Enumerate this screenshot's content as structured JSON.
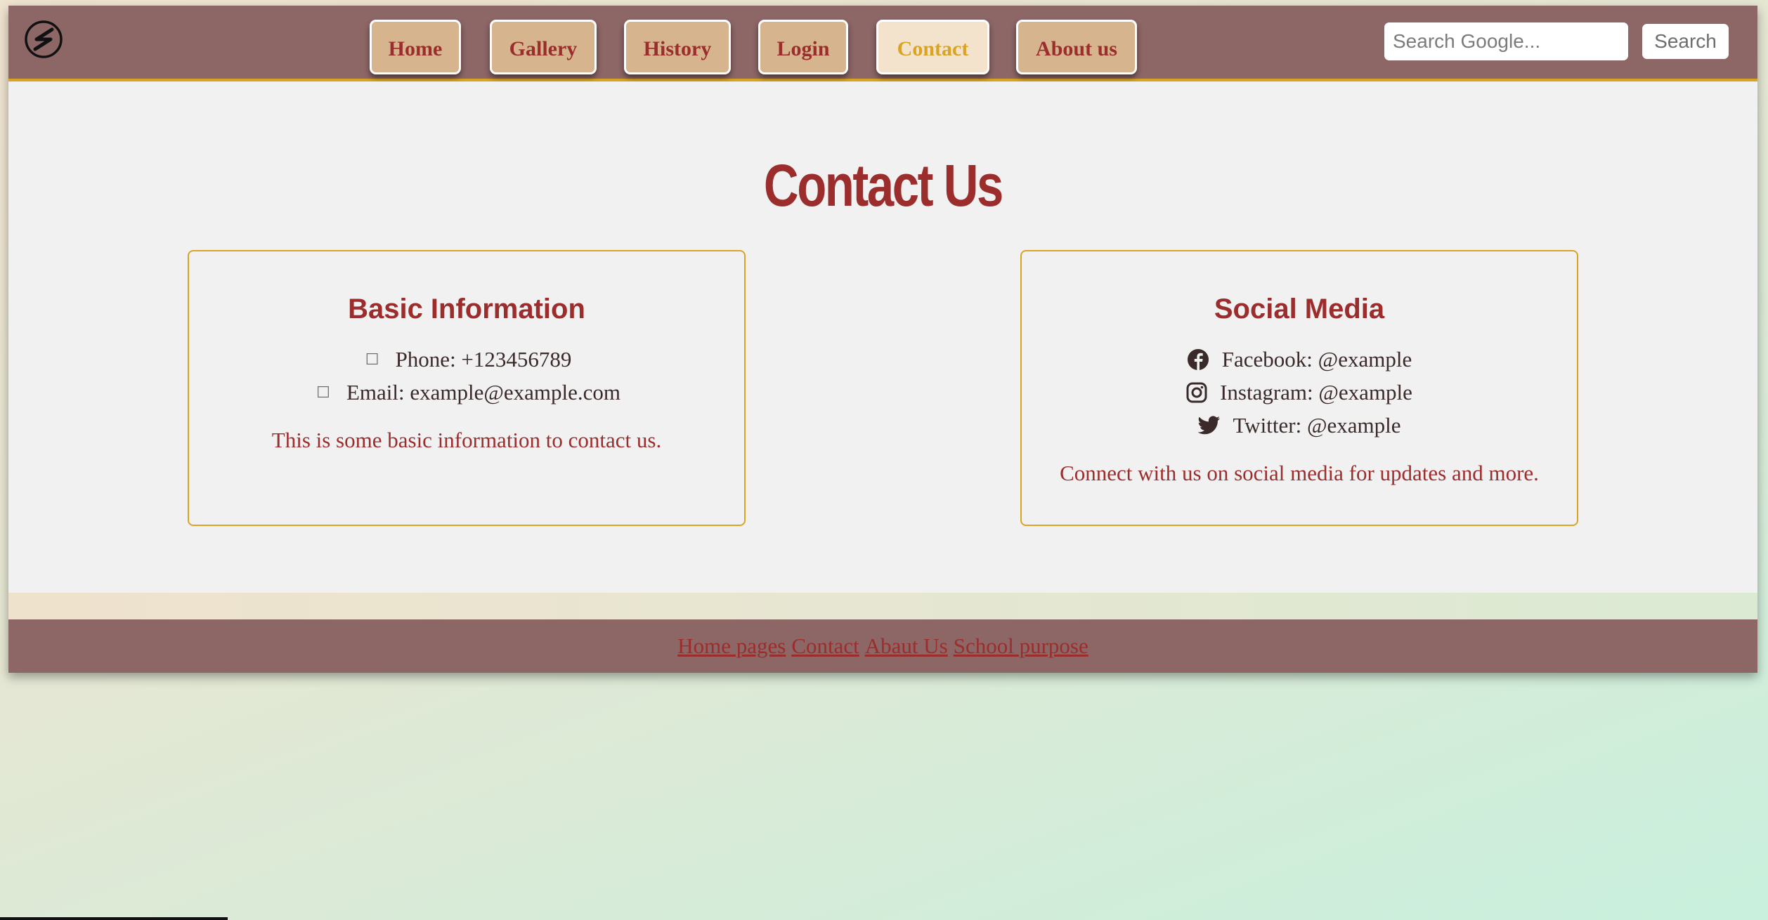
{
  "header": {
    "nav": [
      {
        "label": "Home",
        "active": false
      },
      {
        "label": "Gallery",
        "active": false
      },
      {
        "label": "History",
        "active": false
      },
      {
        "label": "Login",
        "active": false
      },
      {
        "label": "Contact",
        "active": true
      },
      {
        "label": "About us",
        "active": false
      }
    ],
    "search": {
      "placeholder": "Search Google...",
      "button_label": "Search"
    }
  },
  "main": {
    "title": "Contact Us",
    "basic": {
      "title": "Basic Information",
      "phone": "Phone: +123456789",
      "email": "Email: example@example.com",
      "desc": "This is some basic information to contact us."
    },
    "social": {
      "title": "Social Media",
      "facebook": "Facebook: @example",
      "instagram": "Instagram: @example",
      "twitter": "Twitter: @example",
      "desc": "Connect with us on social media for updates and more."
    }
  },
  "footer": {
    "links": [
      "Home pages",
      "Contact",
      "Abaut Us",
      "School purpose"
    ]
  },
  "colors": {
    "header_bg": "#8d6666",
    "accent": "#d9a423",
    "brand_red": "#9b2d2d",
    "nav_button": "#d6b48e"
  }
}
